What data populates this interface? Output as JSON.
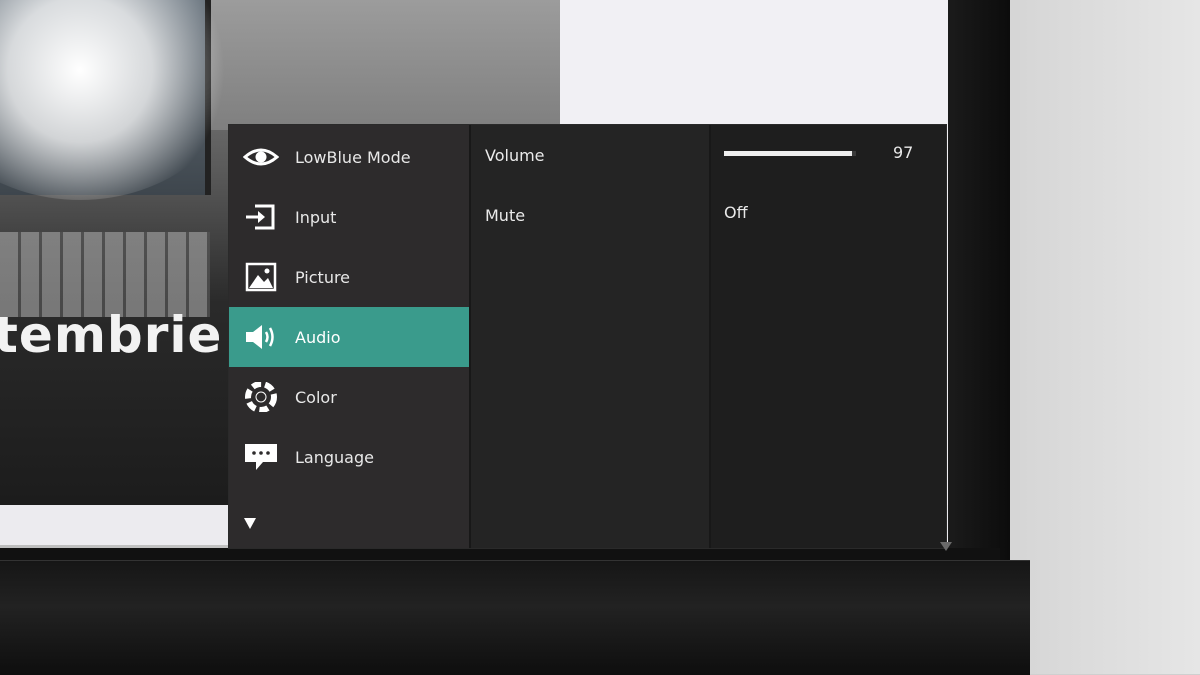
{
  "background": {
    "headline_fragment": "tembrie"
  },
  "osd": {
    "accent_color": "#3a9b8c",
    "menu": [
      {
        "label": "LowBlue Mode",
        "icon": "eye-icon"
      },
      {
        "label": "Input",
        "icon": "input-icon"
      },
      {
        "label": "Picture",
        "icon": "picture-icon"
      },
      {
        "label": "Audio",
        "icon": "speaker-icon",
        "active": true
      },
      {
        "label": "Color",
        "icon": "color-wheel-icon"
      },
      {
        "label": "Language",
        "icon": "speech-bubble-icon"
      }
    ],
    "more_icon": "chevron-down-icon",
    "submenu": [
      {
        "label": "Volume"
      },
      {
        "label": "Mute"
      }
    ],
    "values": {
      "volume": 97,
      "volume_max": 100,
      "volume_text": "97",
      "mute": "Off"
    }
  }
}
